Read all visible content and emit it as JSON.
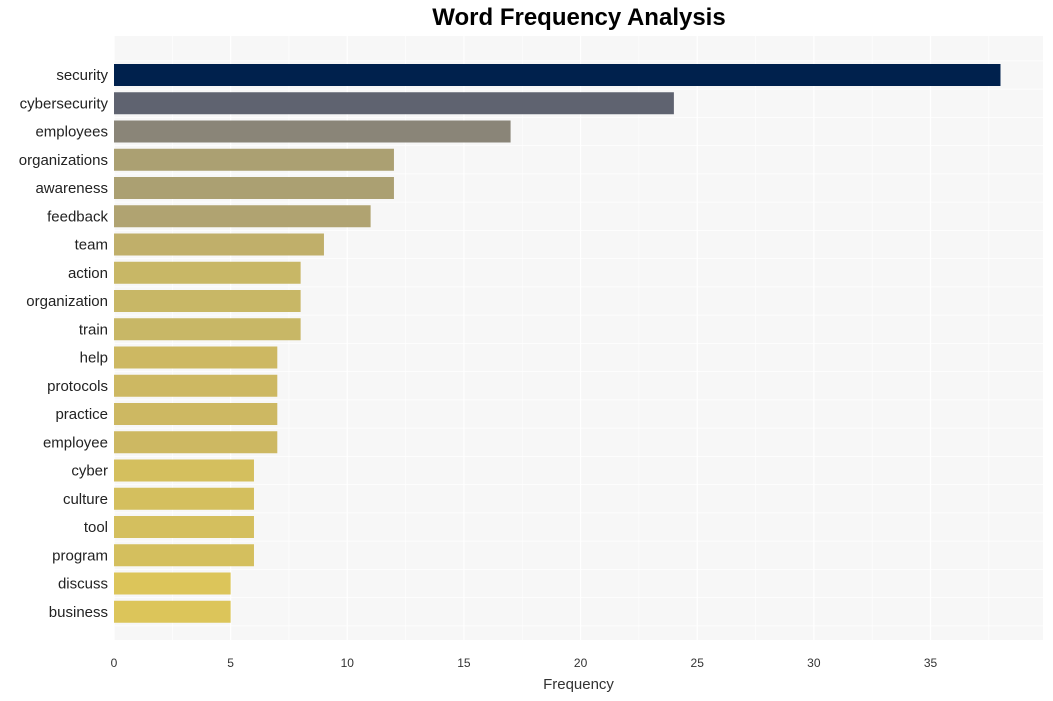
{
  "chart_data": {
    "type": "bar",
    "orientation": "horizontal",
    "title": "Word Frequency Analysis",
    "xlabel": "Frequency",
    "ylabel": "",
    "xlim": [
      0,
      40
    ],
    "xticks": [
      0,
      5,
      10,
      15,
      20,
      25,
      30,
      35
    ],
    "grid": true,
    "legend": "none",
    "categories": [
      "security",
      "cybersecurity",
      "employees",
      "organizations",
      "awareness",
      "feedback",
      "team",
      "action",
      "organization",
      "train",
      "help",
      "protocols",
      "practice",
      "employee",
      "cyber",
      "culture",
      "tool",
      "program",
      "discuss",
      "business"
    ],
    "values": [
      38,
      24,
      17,
      12,
      12,
      11,
      9,
      8,
      8,
      8,
      7,
      7,
      7,
      7,
      6,
      6,
      6,
      6,
      5,
      5
    ],
    "colors": [
      "#00214d",
      "#5f6370",
      "#8a8578",
      "#aba072",
      "#aba072",
      "#b0a371",
      "#c0af6a",
      "#c8b766",
      "#c8b766",
      "#c8b766",
      "#cdb862",
      "#cdb862",
      "#cdb862",
      "#cdb862",
      "#d4bf5e",
      "#d4bf5e",
      "#d4bf5e",
      "#d4bf5e",
      "#dcc55a",
      "#dcc55a"
    ]
  },
  "style": {
    "plot_background": "#f7f7f7",
    "grid_color": "#ffffff"
  }
}
